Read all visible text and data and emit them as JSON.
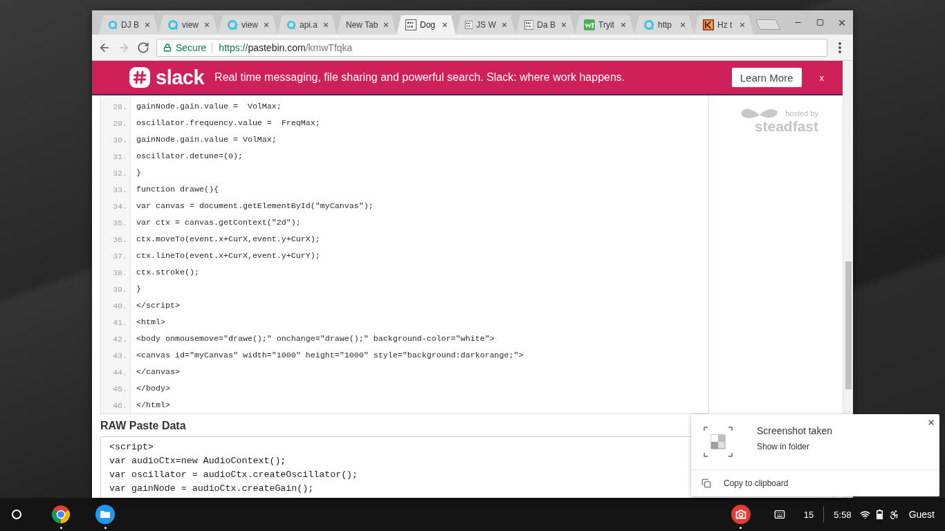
{
  "browser": {
    "tabs": [
      {
        "title": "DJ B",
        "kind": "ring",
        "selected": false
      },
      {
        "title": "view",
        "kind": "ring",
        "selected": false
      },
      {
        "title": "view",
        "kind": "ring",
        "selected": false
      },
      {
        "title": "api.a",
        "kind": "ring",
        "selected": false
      },
      {
        "title": "New Tab",
        "kind": "blank",
        "selected": false
      },
      {
        "title": "Dog",
        "kind": "binary",
        "selected": true
      },
      {
        "title": "JS W",
        "kind": "binary",
        "selected": false
      },
      {
        "title": "Da B",
        "kind": "binary",
        "selected": false
      },
      {
        "title": "Tryit",
        "kind": "w3",
        "selected": false
      },
      {
        "title": "http",
        "kind": "ring",
        "selected": false
      },
      {
        "title": "Hz t",
        "kind": "tile",
        "selected": false
      }
    ],
    "nav": [
      {
        "kind": "back",
        "disabled": false
      },
      {
        "kind": "forward",
        "disabled": true
      },
      {
        "kind": "reload",
        "disabled": false
      }
    ],
    "address": {
      "security": "Secure",
      "scheme": "https://",
      "host": "pastebin.com",
      "path": "/kmwTfqka"
    }
  },
  "banner": {
    "logo_text": "slack",
    "message": "Real time messaging, file sharing and powerful search. Slack: where work happens.",
    "button": "Learn More",
    "close": "x"
  },
  "code": {
    "lines": [
      {
        "number": "28.",
        "text": "gainNode.gain.value =  VolMax;"
      },
      {
        "number": "29.",
        "text": "oscillator.frequency.value =  FreqMax;"
      },
      {
        "number": "30.",
        "text": "gainNode.gain.value = VolMax;"
      },
      {
        "number": "31.",
        "text": "oscillator.detune=(0);"
      },
      {
        "number": "32.",
        "text": "}"
      },
      {
        "number": "33.",
        "text": "function drawe(){"
      },
      {
        "number": "34.",
        "text": "var canvas = document.getElementById(\"myCanvas\");"
      },
      {
        "number": "35.",
        "text": "var ctx = canvas.getContext(\"2d\");"
      },
      {
        "number": "36.",
        "text": "ctx.moveTo(event.x+CurX,event.y+CurX);"
      },
      {
        "number": "37.",
        "text": "ctx.lineTo(event.x+CurX,event.y+CurY);"
      },
      {
        "number": "38.",
        "text": "ctx.stroke();"
      },
      {
        "number": "39.",
        "text": "}"
      },
      {
        "number": "40.",
        "text": "</script>"
      },
      {
        "number": "41.",
        "text": "<html>"
      },
      {
        "number": "42.",
        "text": "<body onmousemove=\"drawe();\" onchange=\"drawe();\" background-color=\"white\">"
      },
      {
        "number": "43.",
        "text": "<canvas id=\"myCanvas\" width=\"1000\" height=\"1000\" style=\"background:darkorange;\">"
      },
      {
        "number": "44.",
        "text": "</canvas>"
      },
      {
        "number": "45.",
        "text": "</body>"
      },
      {
        "number": "46.",
        "text": "</html>"
      }
    ]
  },
  "sidebar": {
    "note": "hosted by",
    "sponsor": "steadfast"
  },
  "raw_paste": {
    "title": "RAW Paste Data",
    "lines": [
      "<script>",
      "var audioCtx=new AudioContext();",
      "var oscillator = audioCtx.createOscillator();",
      "var gainNode = audioCtx.createGain();"
    ]
  },
  "notification": {
    "title": "Screenshot taken",
    "link": "Show in folder",
    "action": "Copy to clipboard"
  },
  "shelf": {
    "apps": [
      {
        "kind": "browser",
        "running": true
      },
      {
        "kind": "files",
        "running": true
      },
      {
        "kind": "screenshot",
        "running": true
      }
    ],
    "tray": {
      "count": "15",
      "time": "5:58",
      "user": "Guest"
    }
  }
}
